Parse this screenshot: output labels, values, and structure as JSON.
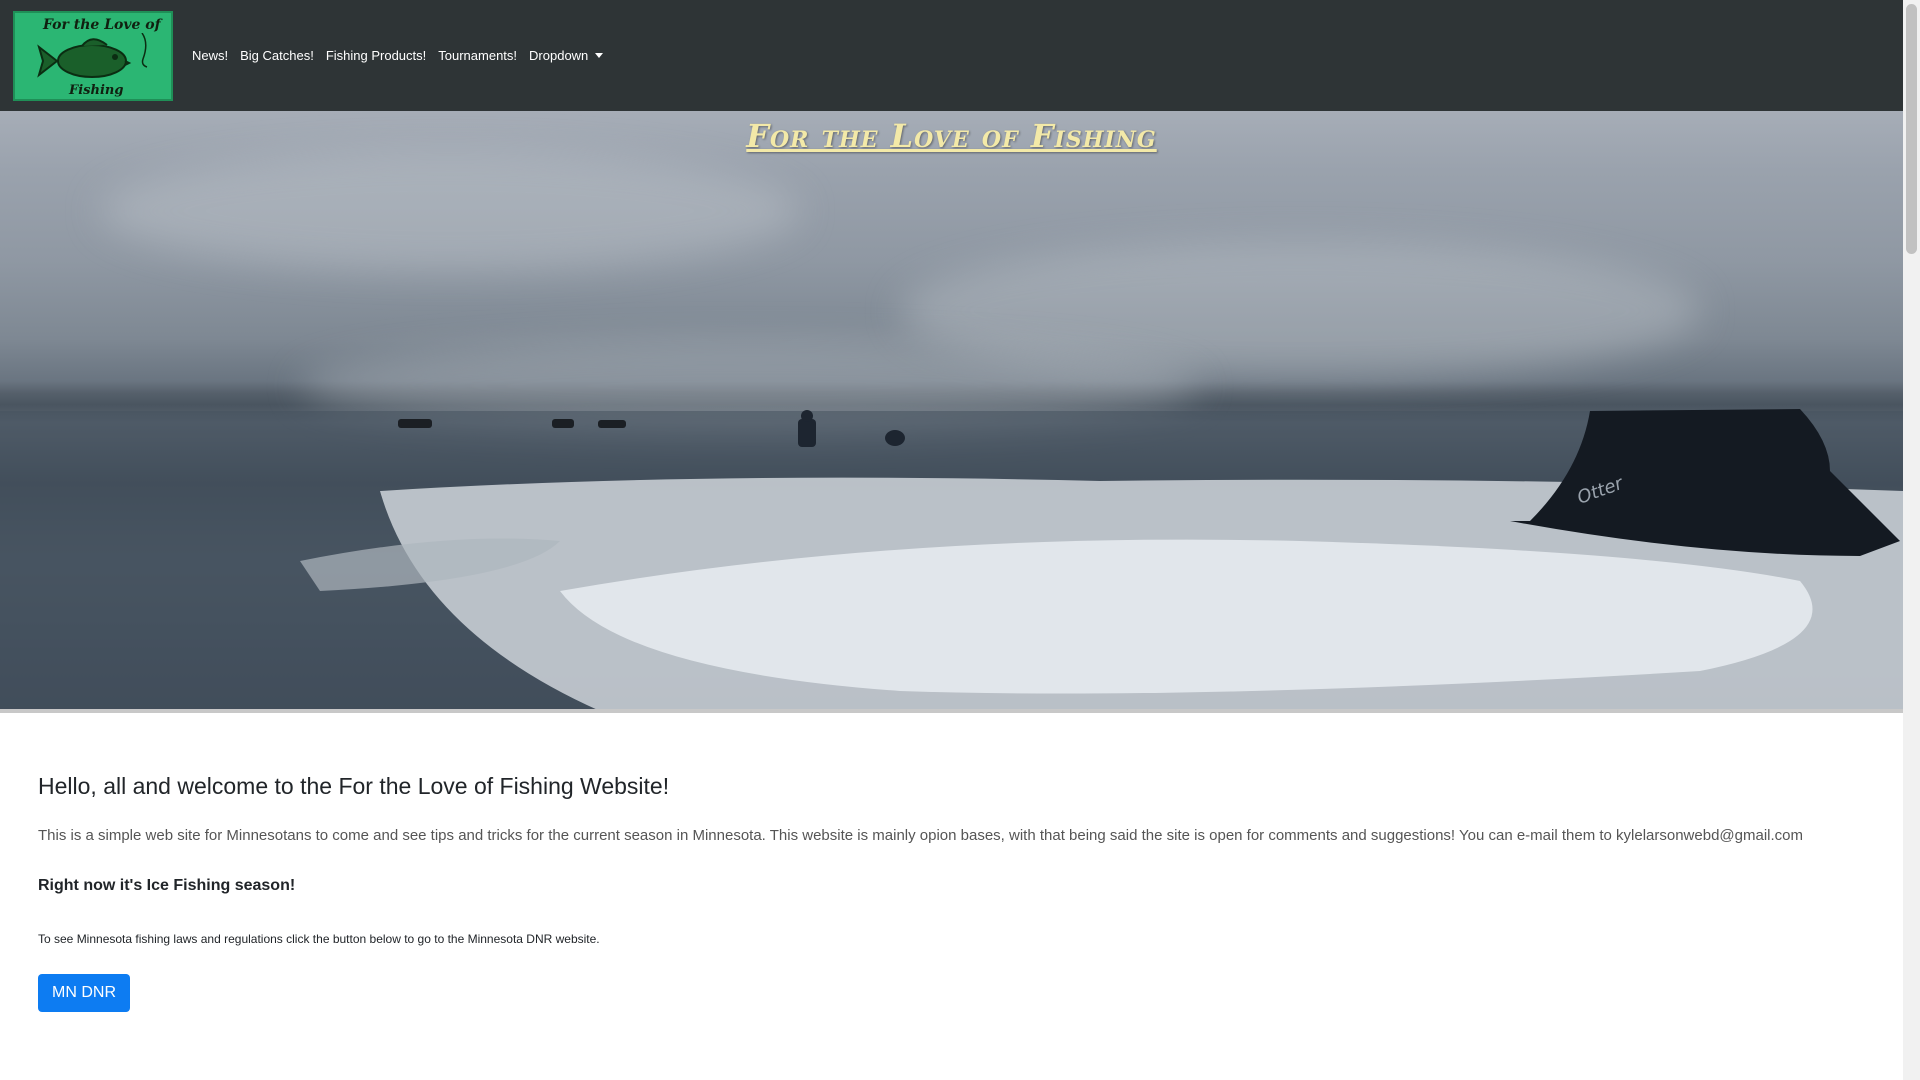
{
  "navbar": {
    "logo": {
      "line1": "For the Love of",
      "line2": "Fishing",
      "icon": "fish-logo-icon",
      "background_color": "#2bb673"
    },
    "links": [
      {
        "label": "News!"
      },
      {
        "label": "Big Catches!"
      },
      {
        "label": "Fishing Products!"
      },
      {
        "label": "Tournaments!"
      },
      {
        "label": "Dropdown"
      }
    ],
    "background_color": "#2e3436"
  },
  "hero": {
    "title": "For the Love of Fishing",
    "title_color": "#f3e9a8"
  },
  "main": {
    "heading": "Hello, all and welcome to the For the Love of Fishing Website!",
    "intro": "This is a simple web site for Minnesotans to come and see tips and tricks for the current season in Minnesota. This website is mainly opion bases, with that being said the site is open for comments and suggestions! You can e-mail them to kylelarsonwebd@gmail.com",
    "season": "Right now it's Ice Fishing season!",
    "dnr_note": "To see Minnesota fishing laws and regulations click the button below to go to the Minnesota DNR website.",
    "dnr_button": "MN DNR",
    "button_color": "#0d7cf2"
  }
}
